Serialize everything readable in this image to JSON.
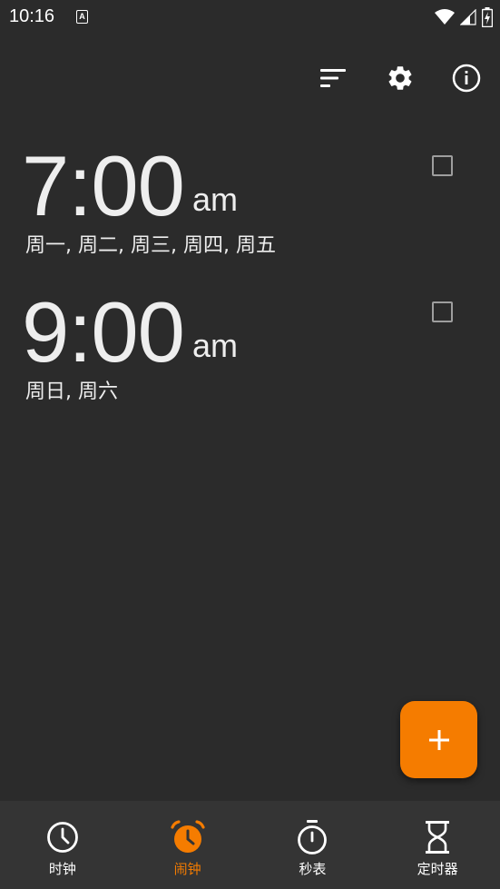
{
  "status_bar": {
    "time": "10:16",
    "notification_icon": "A"
  },
  "toolbar": {
    "icons": [
      "sort-icon",
      "gear-icon",
      "info-icon"
    ]
  },
  "alarms": [
    {
      "time": "7:00",
      "ampm": "am",
      "days": "周一, 周二, 周三, 周四, 周五",
      "enabled": false
    },
    {
      "time": "9:00",
      "ampm": "am",
      "days": "周日, 周六",
      "enabled": false
    }
  ],
  "fab": {
    "icon": "plus-icon"
  },
  "bottom_nav": {
    "items": [
      {
        "label": "时钟",
        "icon": "clock-icon",
        "active": false
      },
      {
        "label": "闹钟",
        "icon": "alarm-clock-icon",
        "active": true
      },
      {
        "label": "秒表",
        "icon": "stopwatch-icon",
        "active": false
      },
      {
        "label": "定时器",
        "icon": "hourglass-icon",
        "active": false
      }
    ]
  },
  "colors": {
    "background": "#2b2b2b",
    "nav_background": "#343434",
    "accent": "#f57c00",
    "text": "#eeeeee",
    "checkbox": "#9e9e9e"
  }
}
